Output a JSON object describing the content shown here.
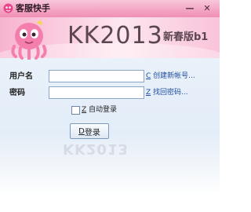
{
  "window": {
    "title": "客服快手",
    "minimize_glyph": "—",
    "close_glyph": "✕"
  },
  "banner": {
    "brand": "KK2013",
    "edition": "新春版b1",
    "reflection": "KK2013"
  },
  "form": {
    "username_label": "用户名",
    "username_value": "",
    "password_label": "密码",
    "password_value": "",
    "create_account_key": "C",
    "create_account_text": "创建新帐号...",
    "recover_password_key": "Z",
    "recover_password_text": "找回密码...",
    "auto_login_key": "Z",
    "auto_login_text": "自动登录",
    "auto_login_checked": false,
    "login_key": "D",
    "login_text": "登录"
  },
  "colors": {
    "titlebar": "#f3a4c3",
    "link": "#1e4ea0",
    "background": "#e3edf8"
  },
  "icons": [
    "app-icon",
    "minimize-icon",
    "close-icon",
    "octopus-mascot-icon"
  ]
}
